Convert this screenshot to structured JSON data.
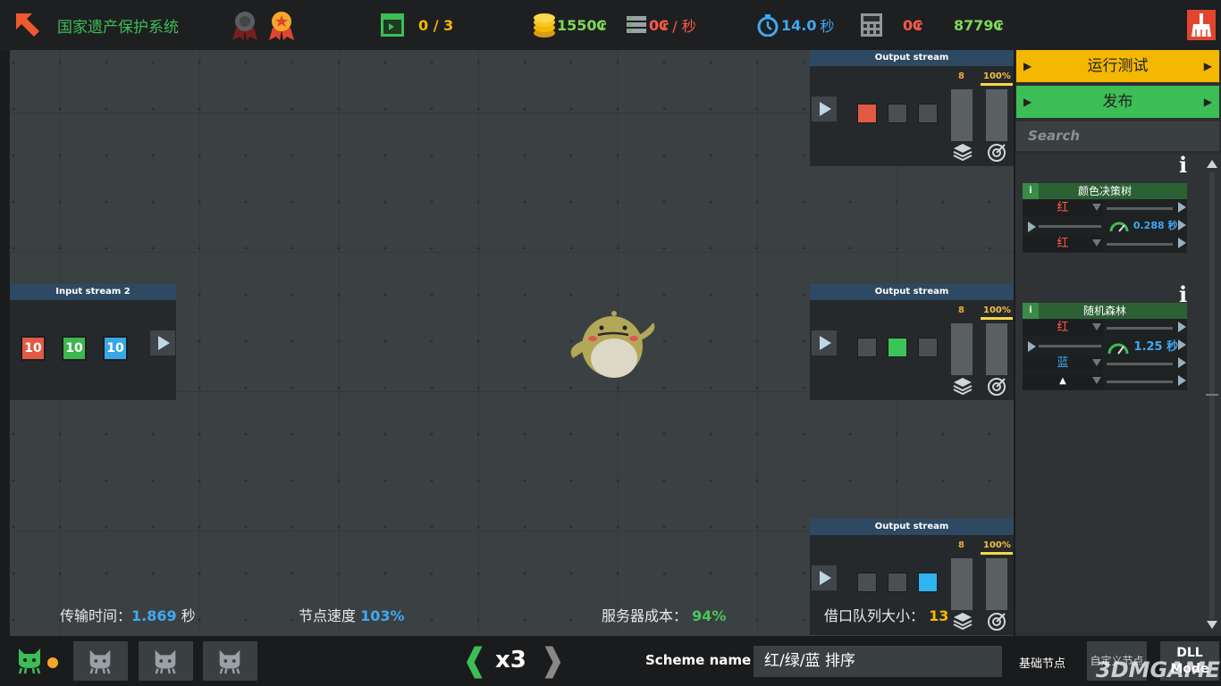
{
  "header": {
    "title": "国家遗产保护系统",
    "challenges": "0 / 3",
    "money": "1550",
    "money_unit": "₢",
    "server_cost_rate": "0₢",
    "server_cost_unit": "/ 秒",
    "time_value": "14.0",
    "time_unit": "秒",
    "calc_value": "0₢",
    "total_value": "8779₢"
  },
  "nodes": {
    "input_stream": {
      "title": "Input stream 2",
      "tokens": [
        {
          "value": "10",
          "color": "#e25a43"
        },
        {
          "value": "10",
          "color": "#3cb64e"
        },
        {
          "value": "10",
          "color": "#37a8e6"
        }
      ]
    },
    "output_streams": [
      {
        "title": "Output stream",
        "count": "8",
        "percent": "100%",
        "active_slot": 0,
        "active_color": "#e25a43"
      },
      {
        "title": "Output stream",
        "count": "8",
        "percent": "100%",
        "active_slot": 1,
        "active_color": "#3cc557"
      },
      {
        "title": "Output stream",
        "count": "8",
        "percent": "100%",
        "active_slot": 2,
        "active_color": "#2fb4f0"
      }
    ]
  },
  "stats": {
    "transfer_label": "传输时间：",
    "transfer_value": "1.869",
    "transfer_unit": "秒",
    "node_speed_label": "节点速度",
    "node_speed_value": "103%",
    "server_cost_label": "服务器成本：",
    "server_cost_value": "94%",
    "queue_label": "借口队列大小：",
    "queue_value": "13"
  },
  "right_panel": {
    "run_test_label": "运行测试",
    "publish_label": "发布",
    "search_placeholder": "Search",
    "palette": [
      {
        "info": "i",
        "title": "颜色决策树",
        "row1": "红",
        "row2": "红",
        "speed": "0.288 秒"
      },
      {
        "info": "i",
        "title": "随机森林",
        "row1": "红",
        "row2": "蓝",
        "row3": "▲",
        "speed": "1.25 秒"
      }
    ]
  },
  "bottom": {
    "speed_multiplier": "x3",
    "scheme_label": "Scheme name :",
    "scheme_value": "红/绿/蓝 排序",
    "tab_basic": "基础节点",
    "tab_custom": "自定义节点",
    "dll_line1": "DLL",
    "dll_line2": "Mode",
    "watermark": "3DMGAME"
  },
  "colors": {
    "accent_yellow": "#f5b800",
    "accent_green": "#3dbd56",
    "value_blue": "#3fa9f5",
    "value_green": "#46c85a",
    "money_green": "#7ed957",
    "cost_red": "#ff5a4a"
  }
}
